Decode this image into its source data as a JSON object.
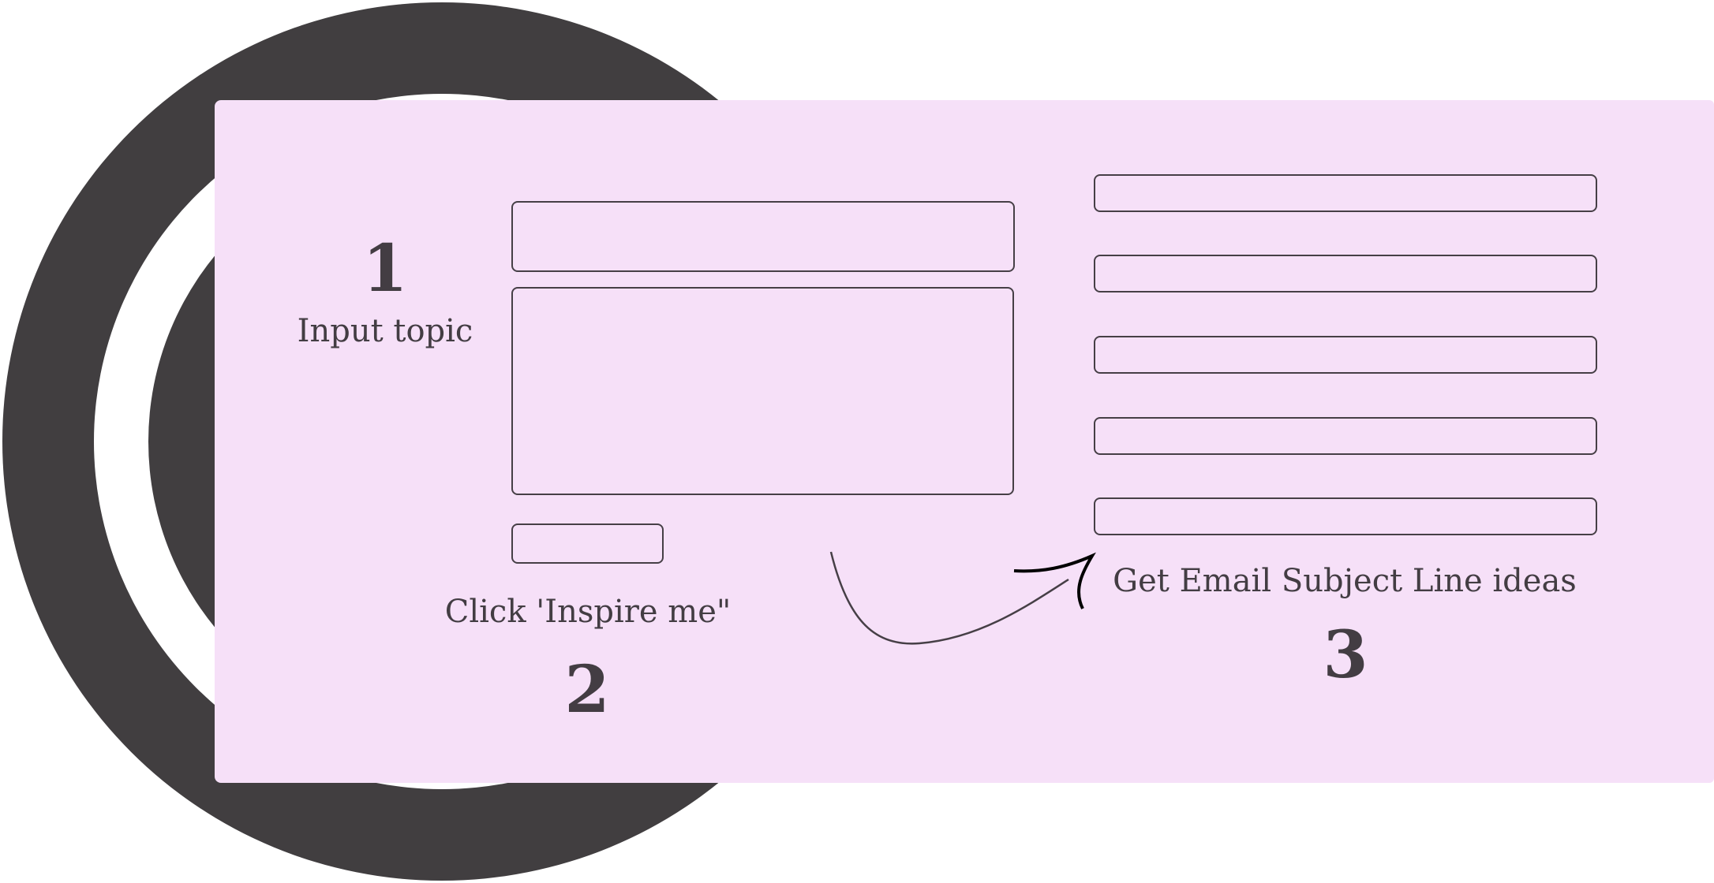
{
  "colors": {
    "ring": "#413e40",
    "panel": "#f6e0f8",
    "outline": "#463f46",
    "text": "#433d43"
  },
  "steps": [
    {
      "number": "1",
      "label": "Input topic"
    },
    {
      "number": "2",
      "label": "Click 'Inspire me\""
    },
    {
      "number": "3",
      "label": "Get Email Subject Line ideas"
    }
  ],
  "input_area": {
    "topic_field": "",
    "details_field": "",
    "inspire_button": ""
  },
  "results": [
    "",
    "",
    "",
    "",
    ""
  ]
}
